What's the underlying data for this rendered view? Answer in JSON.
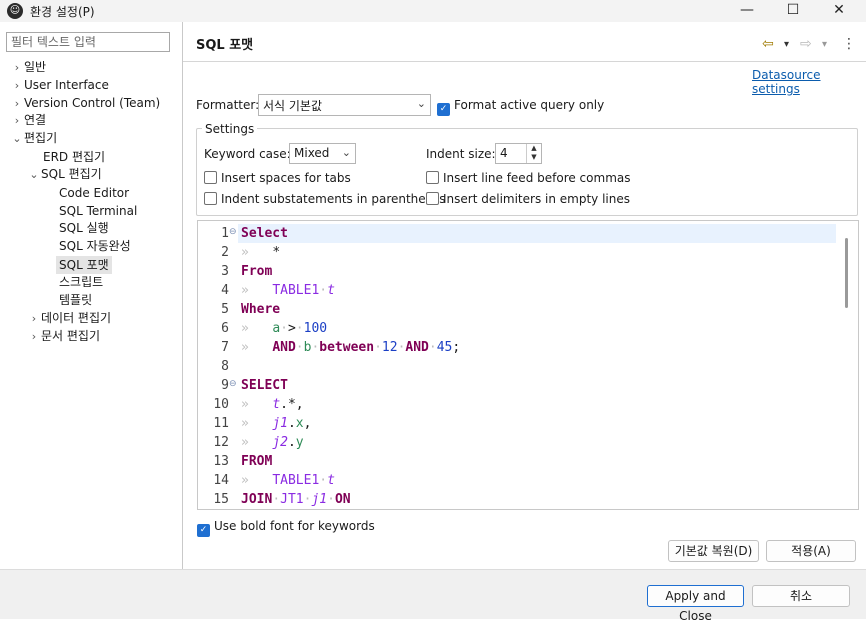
{
  "window": {
    "title": "환경 설정(P)",
    "controls": [
      "—",
      "☐",
      "✕"
    ]
  },
  "sidebar": {
    "filter_placeholder": "필터 텍스트 입력",
    "items": [
      {
        "label": "일반",
        "twisty": "›"
      },
      {
        "label": "User Interface",
        "twisty": "›"
      },
      {
        "label": "Version Control (Team)",
        "twisty": "›"
      },
      {
        "label": "연결",
        "twisty": "›"
      },
      {
        "label": "편집기",
        "twisty": "⌄"
      },
      {
        "label": "ERD 편집기",
        "twisty": ""
      },
      {
        "label": "SQL 편집기",
        "twisty": "⌄"
      },
      {
        "label": "Code Editor",
        "twisty": ""
      },
      {
        "label": "SQL Terminal",
        "twisty": ""
      },
      {
        "label": "SQL 실행",
        "twisty": ""
      },
      {
        "label": "SQL 자동완성",
        "twisty": ""
      },
      {
        "label": "SQL 포맷",
        "twisty": ""
      },
      {
        "label": "스크립트",
        "twisty": ""
      },
      {
        "label": "템플릿",
        "twisty": ""
      },
      {
        "label": "데이터 편집기",
        "twisty": "›"
      },
      {
        "label": "문서 편집기",
        "twisty": "›"
      }
    ]
  },
  "page": {
    "title": "SQL 포맷",
    "nav": {
      "back": "⇦",
      "forward": "⇨",
      "dropdown": "▾",
      "menu": "⋮"
    },
    "datasource_link": "Datasource settings",
    "formatter_label": "Formatter:",
    "formatter_value": "서식 기본값",
    "format_active_label": "Format active query only",
    "format_active_checked": true,
    "settings_title": "Settings",
    "keyword_case_label": "Keyword case:",
    "keyword_case_value": "Mixed",
    "indent_size_label": "Indent size:",
    "indent_size_value": "4",
    "insert_spaces_label": "Insert spaces for tabs",
    "indent_sub_label": "Indent substatements in parentheses",
    "insert_lf_label": "Insert line feed before commas",
    "insert_delim_label": "Insert delimiters in empty lines",
    "bold_font_label": "Use bold font for keywords",
    "bold_font_checked": true,
    "restore_defaults": "기본값 복원(D)",
    "apply": "적용(A)"
  },
  "editor": {
    "line_numbers": [
      "1",
      "2",
      "3",
      "4",
      "5",
      "6",
      "7",
      "8",
      "9",
      "10",
      "11",
      "12",
      "13",
      "14",
      "15"
    ],
    "tokens": {
      "select1": "Select",
      "star": "*",
      "from1": "From",
      "table1": "TABLE1",
      "t": "t",
      "where": "Where",
      "a": "a",
      "gt": ">",
      "n100": "100",
      "and1": "AND",
      "b": "b",
      "between": "between",
      "n12": "12",
      "and2": "AND",
      "n45": "45",
      "semi": ";",
      "select2": "SELECT",
      "t2": "t",
      "dotstar": ".*,",
      "j1": "j1",
      "x": "x",
      "j2": "j2",
      "y": "y",
      "from2": "FROM",
      "table1b": "TABLE1",
      "t3": "t",
      "join": "JOIN",
      "jt1": "JT1",
      "j1b": "j1",
      "on": "ON"
    }
  },
  "footer": {
    "apply_close": "Apply and Close",
    "cancel": "취소"
  }
}
